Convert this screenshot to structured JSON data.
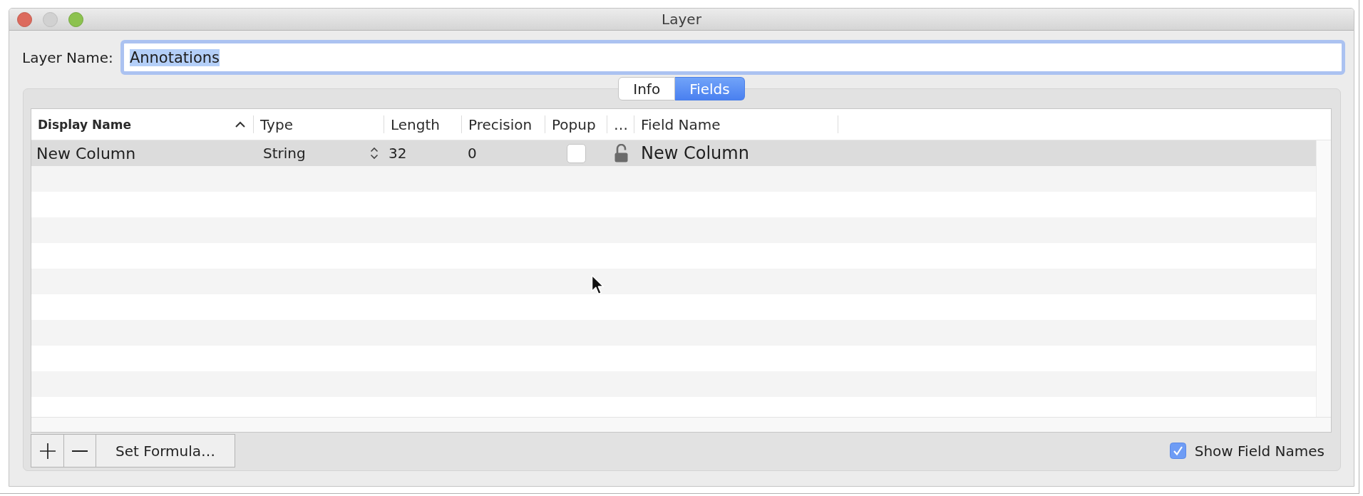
{
  "window": {
    "title": "Layer",
    "buttons": [
      {
        "kind": "close",
        "disabled": false
      },
      {
        "kind": "minimize",
        "disabled": true
      },
      {
        "kind": "zoom",
        "disabled": false
      }
    ]
  },
  "layer_name": {
    "label": "Layer Name:",
    "value": "Annotations",
    "value_selected": true
  },
  "tabs": [
    {
      "label": "Info",
      "selected": false
    },
    {
      "label": "Fields",
      "selected": true
    }
  ],
  "table": {
    "columns": [
      {
        "label": "Display Name",
        "sorted": true
      },
      {
        "label": "Type",
        "sorted": false
      },
      {
        "label": "Length",
        "sorted": false
      },
      {
        "label": "Precision",
        "sorted": false
      },
      {
        "label": "Popup",
        "sorted": false
      },
      {
        "label": "…",
        "sorted": false
      },
      {
        "label": "Field Name",
        "sorted": false
      }
    ],
    "rows": [
      {
        "selected": true,
        "display_name": "New Column",
        "type": "String",
        "length": "32",
        "precision": "0",
        "popup": false,
        "locked": false,
        "field_name": "New Column"
      }
    ]
  },
  "toolbar": {
    "buttons": [
      {
        "kind": "add"
      },
      {
        "kind": "remove"
      },
      {
        "kind": "text",
        "label": "Set Formula…"
      }
    ]
  },
  "show_field_names": {
    "label": "Show Field Names",
    "checked": true
  }
}
